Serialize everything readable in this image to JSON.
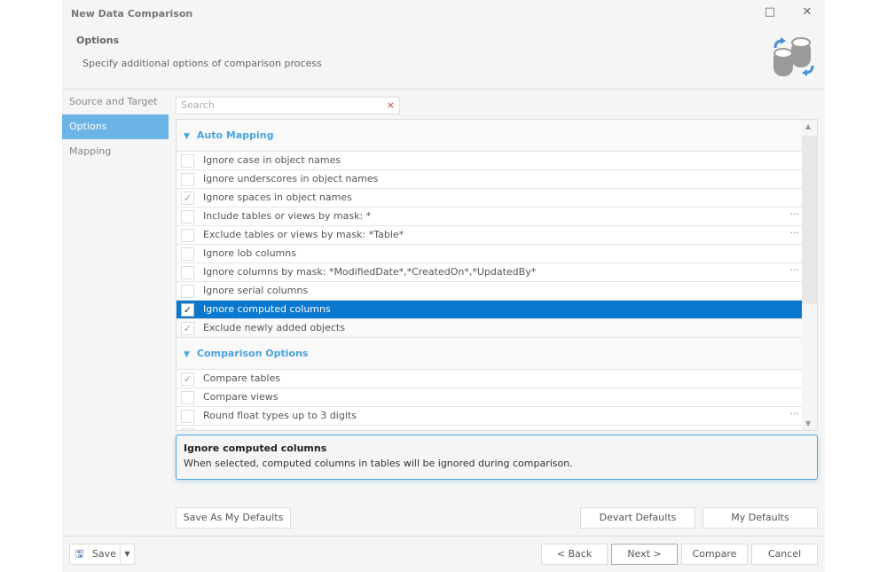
{
  "window": {
    "title": "New Data Comparison",
    "maximize_icon": "□",
    "close_icon": "✕"
  },
  "header": {
    "title": "Options",
    "subtitle": "Specify additional options of comparison process",
    "icon": "database-compare-icon"
  },
  "sidebar": {
    "items": [
      {
        "label": "Source and Target"
      },
      {
        "label": "Options",
        "active": true
      },
      {
        "label": "Mapping"
      }
    ]
  },
  "search": {
    "placeholder": "Search",
    "clear_icon": "×"
  },
  "groups": [
    {
      "title": "Auto Mapping",
      "items": [
        {
          "label": "Ignore case in object names",
          "checked": false
        },
        {
          "label": "Ignore underscores in object names",
          "checked": false
        },
        {
          "label": "Ignore spaces in object names",
          "checked": true
        },
        {
          "label": "Include tables or views by mask: *",
          "checked": false,
          "more": true
        },
        {
          "label": "Exclude tables or views by mask: *Table*",
          "checked": false,
          "more": true
        },
        {
          "label": "Ignore lob columns",
          "checked": false
        },
        {
          "label": "Ignore columns by mask: *ModifiedDate*,*CreatedOn*,*UpdatedBy*",
          "checked": false,
          "more": true
        },
        {
          "label": "Ignore serial columns",
          "checked": false
        },
        {
          "label": "Ignore computed columns",
          "checked": true,
          "selected": true
        },
        {
          "label": "Exclude newly added objects",
          "checked": true
        }
      ]
    },
    {
      "title": "Comparison Options",
      "items": [
        {
          "label": "Compare tables",
          "checked": true
        },
        {
          "label": "Compare views",
          "checked": false
        },
        {
          "label": "Round float types up to 3 digits",
          "checked": false,
          "more": true
        },
        {
          "label": "",
          "checked": false
        }
      ]
    }
  ],
  "description": {
    "title": "Ignore computed columns",
    "text": "When selected, computed columns in tables will be ignored during comparison."
  },
  "buttons": {
    "save_as_defaults": "Save As My Defaults",
    "devart_defaults": "Devart Defaults",
    "my_defaults": "My Defaults",
    "save": "Save",
    "back": "< Back",
    "next": "Next >",
    "compare": "Compare",
    "cancel": "Cancel"
  }
}
